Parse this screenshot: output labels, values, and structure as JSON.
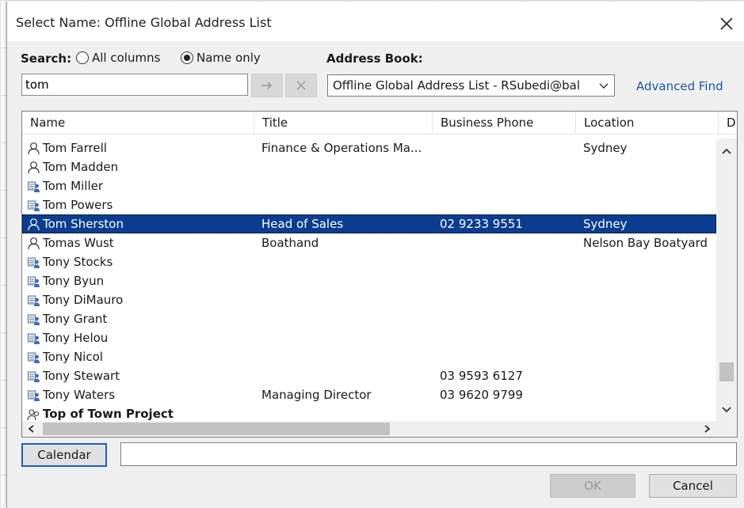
{
  "dialog": {
    "title": "Select Name: Offline Global Address List",
    "close_icon": "close-icon"
  },
  "search": {
    "label": "Search:",
    "option_all": "All columns",
    "option_name": "Name only",
    "selected": "Name only",
    "query": "tom",
    "go_icon": "arrow-right-icon",
    "clear_icon": "clear-icon"
  },
  "address_book": {
    "label": "Address Book:",
    "value": "Offline Global Address List - RSubedi@bal",
    "advanced_find": "Advanced Find"
  },
  "columns": [
    "Name",
    "Title",
    "Business Phone",
    "Location",
    "D"
  ],
  "rows": [
    {
      "icon": "person-icon",
      "name": "Tom Farrell",
      "title": "Finance & Operations Ma...",
      "phone": "",
      "location": "Sydney"
    },
    {
      "icon": "person-icon",
      "name": "Tom Madden",
      "title": "",
      "phone": "",
      "location": ""
    },
    {
      "icon": "room-icon",
      "name": "Tom Miller",
      "title": "",
      "phone": "",
      "location": ""
    },
    {
      "icon": "room-icon",
      "name": "Tom Powers",
      "title": "",
      "phone": "",
      "location": ""
    },
    {
      "icon": "person-icon",
      "name": "Tom Sherston",
      "title": "Head of Sales",
      "phone": "02 9233 9551",
      "location": "Sydney",
      "selected": true
    },
    {
      "icon": "person-icon",
      "name": "Tomas Wust",
      "title": "Boathand",
      "phone": "",
      "location": "Nelson Bay Boatyard"
    },
    {
      "icon": "room-icon",
      "name": "Tony  Stocks",
      "title": "",
      "phone": "",
      "location": ""
    },
    {
      "icon": "room-icon",
      "name": "Tony Byun",
      "title": "",
      "phone": "",
      "location": ""
    },
    {
      "icon": "room-icon",
      "name": "Tony DiMauro",
      "title": "",
      "phone": "",
      "location": ""
    },
    {
      "icon": "room-icon",
      "name": "Tony Grant",
      "title": "",
      "phone": "",
      "location": ""
    },
    {
      "icon": "room-icon",
      "name": "Tony Helou",
      "title": "",
      "phone": "",
      "location": ""
    },
    {
      "icon": "room-icon",
      "name": "Tony Nicol",
      "title": "",
      "phone": "",
      "location": ""
    },
    {
      "icon": "room-icon",
      "name": "Tony Stewart",
      "title": "",
      "phone": "03 9593 6127",
      "location": ""
    },
    {
      "icon": "room-icon",
      "name": "Tony Waters",
      "title": "Managing Director",
      "phone": "03 9620 9799",
      "location": ""
    },
    {
      "icon": "group-icon",
      "name": "Top of Town Project",
      "title": "",
      "phone": "",
      "location": "",
      "bold": true
    }
  ],
  "footer": {
    "calendar": "Calendar",
    "to_value": "",
    "ok": "OK",
    "cancel": "Cancel"
  }
}
